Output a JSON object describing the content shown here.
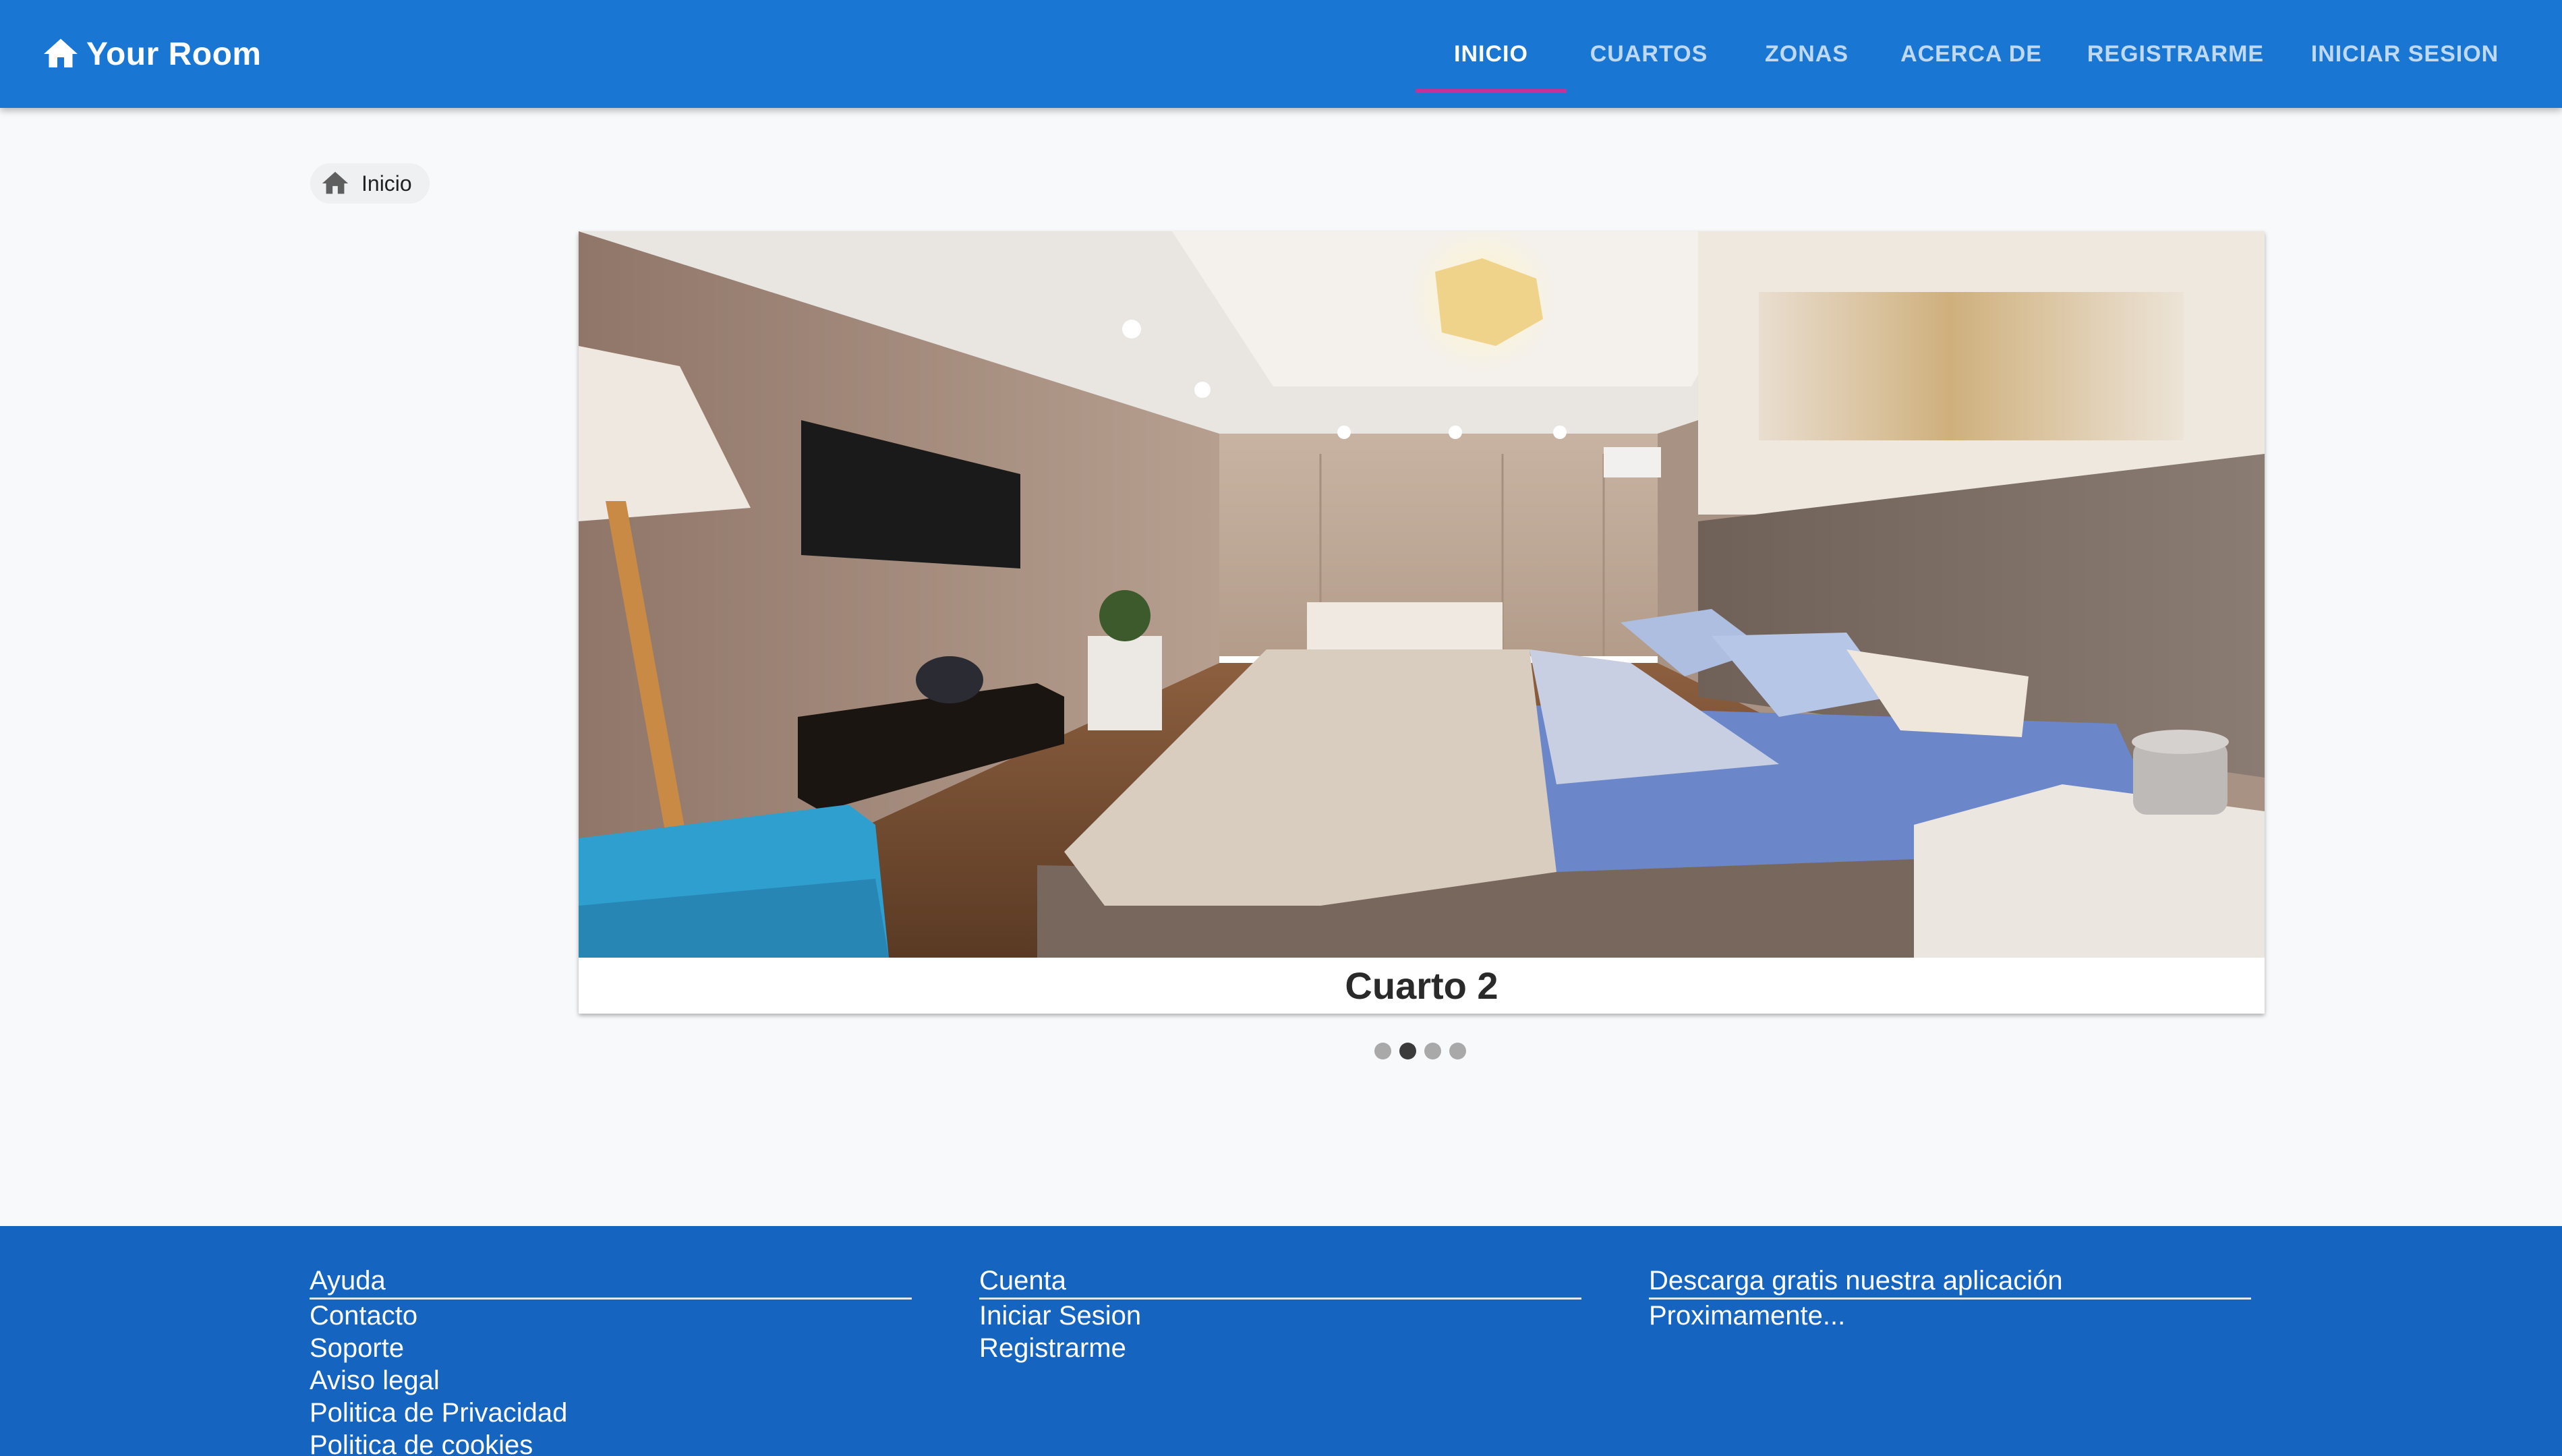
{
  "app": {
    "brand": "Your Room",
    "brand_icon": "home-icon",
    "primary_color": "#1976d2",
    "footer_color": "#1565c0",
    "indicator_color": "#c2339a"
  },
  "nav": {
    "tabs": [
      {
        "label": "INICIO",
        "active": true
      },
      {
        "label": "CUARTOS",
        "active": false
      },
      {
        "label": "ZONAS",
        "active": false
      },
      {
        "label": "ACERCA DE",
        "active": false
      },
      {
        "label": "REGISTRARME",
        "active": false
      },
      {
        "label": "INICIAR SESION",
        "active": false
      }
    ]
  },
  "breadcrumb": {
    "icon": "home-icon",
    "label": "Inicio"
  },
  "carousel": {
    "caption": "Cuarto 2",
    "slide_count": 4,
    "active_index": 1,
    "image": "bedroom-photo"
  },
  "footer": {
    "columns": [
      {
        "title": "Ayuda",
        "links": [
          "Contacto",
          "Soporte",
          "Aviso legal",
          "Politica de Privacidad",
          "Politica de cookies"
        ]
      },
      {
        "title": "Cuenta",
        "links": [
          "Iniciar Sesion",
          "Registrarme"
        ]
      },
      {
        "title": "Descarga gratis nuestra aplicación",
        "text": "Proximamente..."
      }
    ]
  }
}
